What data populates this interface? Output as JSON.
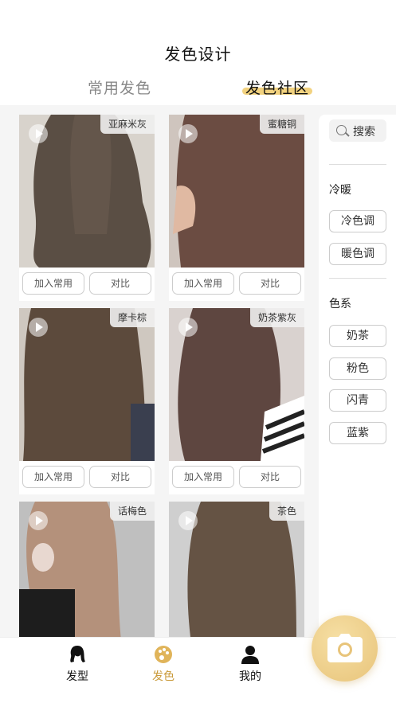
{
  "header": {
    "title": "发色设计"
  },
  "tabs": [
    {
      "label": "常用发色",
      "active": false
    },
    {
      "label": "发色社区",
      "active": true
    }
  ],
  "cards": [
    {
      "tag": "亚麻米灰",
      "add_label": "加入常用",
      "compare_label": "对比",
      "color": "#5a4e44",
      "bg": "#d6d1cb"
    },
    {
      "tag": "蜜糖铜",
      "add_label": "加入常用",
      "compare_label": "对比",
      "color": "#6b4c42",
      "bg": "#cfc5be"
    },
    {
      "tag": "摩卡棕",
      "add_label": "加入常用",
      "compare_label": "对比",
      "color": "#5c4a3c",
      "bg": "#cfc8c0"
    },
    {
      "tag": "奶茶紫灰",
      "add_label": "加入常用",
      "compare_label": "对比",
      "color": "#5e4640",
      "bg": "#d9d2cf"
    },
    {
      "tag": "话梅色",
      "add_label": "",
      "compare_label": "",
      "color": "#b4917b",
      "bg": "#bfbfbf"
    },
    {
      "tag": "茶色",
      "add_label": "",
      "compare_label": "",
      "color": "#655344",
      "bg": "#cfcfcf"
    }
  ],
  "sidebar": {
    "search_label": "搜索",
    "section1_title": "冷暖",
    "section1_items": [
      "冷色调",
      "暖色调"
    ],
    "section2_title": "色系",
    "section2_items": [
      "奶茶",
      "粉色",
      "闪青",
      "蓝紫"
    ]
  },
  "bottom_nav": [
    {
      "label": "发型",
      "icon": "hair-style-icon",
      "active": false
    },
    {
      "label": "发色",
      "icon": "palette-icon",
      "active": true
    },
    {
      "label": "我的",
      "icon": "user-icon",
      "active": false
    }
  ],
  "colors": {
    "accent": "#c99a3a",
    "highlight": "#f2d27f",
    "camera": "#e8c47a"
  },
  "camera_icon": "camera-icon"
}
